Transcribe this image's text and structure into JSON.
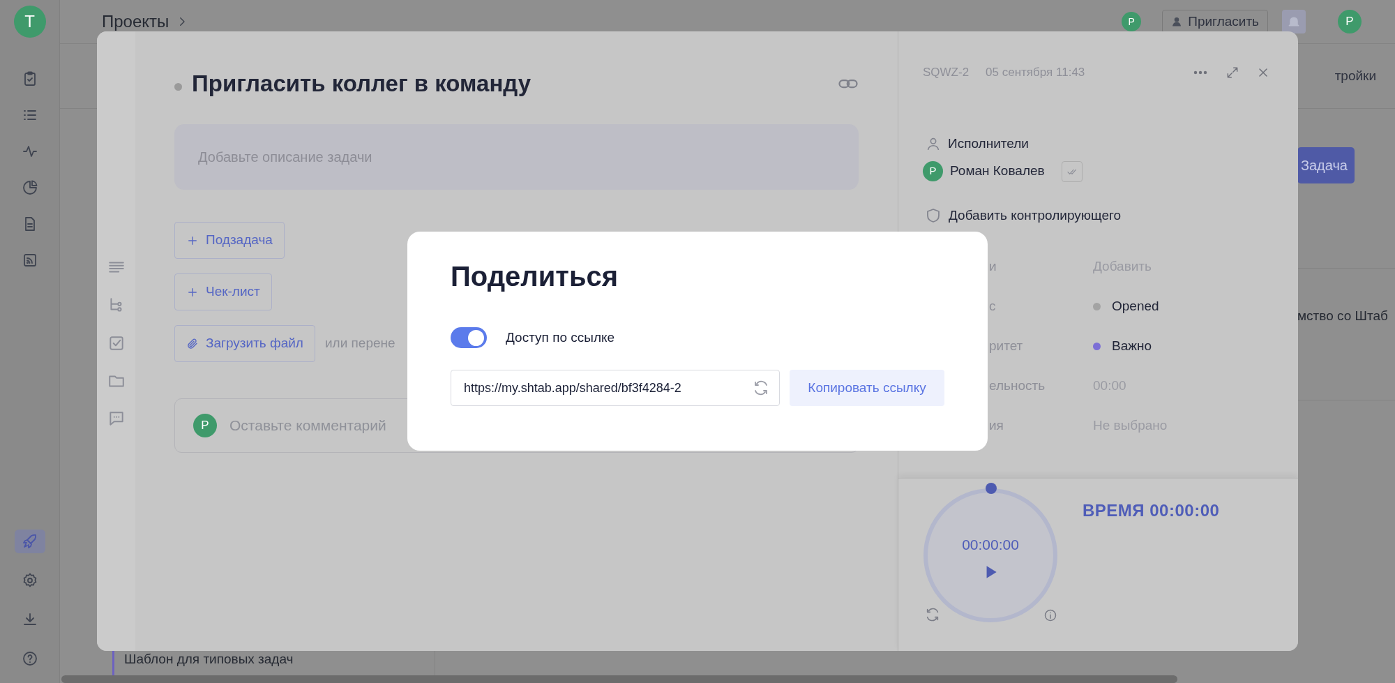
{
  "app_sidebar": {
    "logo": "Т",
    "nav_top": [
      {
        "kind": "clipboard",
        "selected": false
      },
      {
        "kind": "list",
        "selected": false
      },
      {
        "kind": "pulse",
        "selected": false
      },
      {
        "kind": "pie",
        "selected": false
      },
      {
        "kind": "document",
        "selected": false
      },
      {
        "kind": "feed",
        "selected": false
      }
    ],
    "nav_bottom": [
      {
        "kind": "rocket",
        "selected": true
      },
      {
        "kind": "settings",
        "selected": false
      },
      {
        "kind": "download",
        "selected": false
      },
      {
        "kind": "help",
        "selected": false
      }
    ]
  },
  "header": {
    "breadcrumb": "Проекты",
    "user_avatar": "Р",
    "invite_button": "Пригласить",
    "profile_avatar": "Р"
  },
  "background": {
    "settings_tab": "тройки",
    "task_button": "Задача",
    "list_item": "мство со Штаб",
    "template_item": "Шаблон для типовых задач"
  },
  "task": {
    "title": "Пригласить коллег в команду",
    "description_placeholder": "Добавьте описание задачи",
    "side_tools": [
      {
        "kind": "text"
      },
      {
        "kind": "subtasks"
      },
      {
        "kind": "checklist"
      },
      {
        "kind": "folder"
      },
      {
        "kind": "comments"
      }
    ],
    "actions": [
      {
        "kind": "plus",
        "label": "Подзадача"
      },
      {
        "kind": "plus",
        "label": "Чек-лист"
      },
      {
        "kind": "attach",
        "label": "Загрузить файл"
      }
    ],
    "drop_hint": "или перене",
    "comment": {
      "avatar": "Р",
      "placeholder": "Оставьте комментарий"
    }
  },
  "details": {
    "key": "SQWZ-2",
    "date": "05 сентября 11:43",
    "assignees_label": "Исполнители",
    "assignee": {
      "avatar": "Р",
      "name": "Роман Ковалев"
    },
    "add_controller": "Добавить контролирующего",
    "fields": [
      {
        "label": "и",
        "placeholder": "Добавить",
        "kind": "empty"
      },
      {
        "label": "с",
        "value": "Opened",
        "kind": "dot",
        "color": "#a3a3a3"
      },
      {
        "label": "ритет",
        "value": "Важно",
        "kind": "dot",
        "color": "#7c6fd6"
      },
      {
        "label": "ельность",
        "placeholder": "00:00",
        "kind": "empty"
      },
      {
        "label": "ия",
        "placeholder": "Не выбрано",
        "kind": "empty"
      }
    ]
  },
  "timer": {
    "display": "00:00:00",
    "title": "ВРЕМЯ 00:00:00"
  },
  "share_dialog": {
    "title": "Поделиться",
    "link_access": {
      "label": "Доступ по ссылке",
      "on": true
    },
    "url": "https://my.shtab.app/shared/bf3f4284-2",
    "copy_button": "Копировать ссылку"
  }
}
